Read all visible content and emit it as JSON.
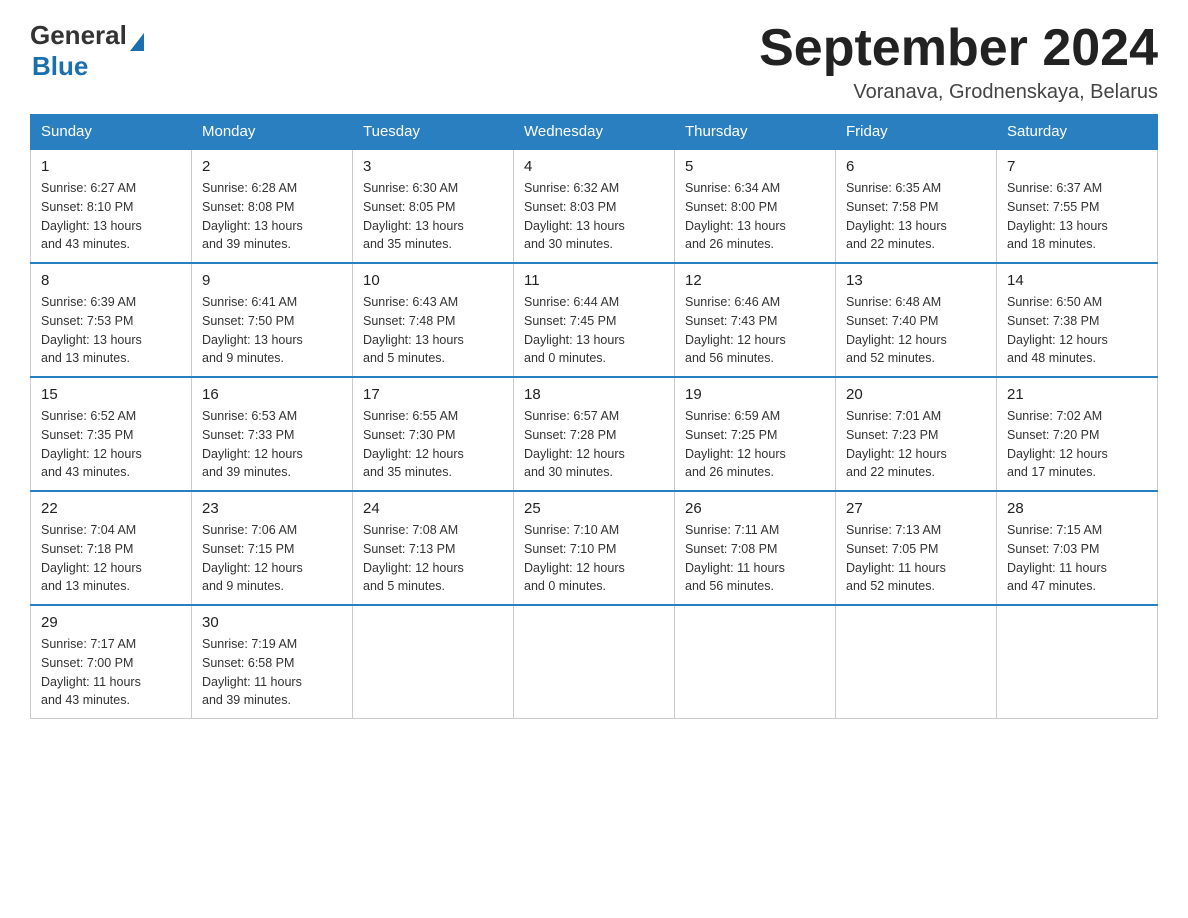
{
  "header": {
    "logo_general": "General",
    "logo_blue": "Blue",
    "month_title": "September 2024",
    "subtitle": "Voranava, Grodnenskaya, Belarus"
  },
  "days_of_week": [
    "Sunday",
    "Monday",
    "Tuesday",
    "Wednesday",
    "Thursday",
    "Friday",
    "Saturday"
  ],
  "weeks": [
    [
      {
        "day": "1",
        "info": "Sunrise: 6:27 AM\nSunset: 8:10 PM\nDaylight: 13 hours\nand 43 minutes."
      },
      {
        "day": "2",
        "info": "Sunrise: 6:28 AM\nSunset: 8:08 PM\nDaylight: 13 hours\nand 39 minutes."
      },
      {
        "day": "3",
        "info": "Sunrise: 6:30 AM\nSunset: 8:05 PM\nDaylight: 13 hours\nand 35 minutes."
      },
      {
        "day": "4",
        "info": "Sunrise: 6:32 AM\nSunset: 8:03 PM\nDaylight: 13 hours\nand 30 minutes."
      },
      {
        "day": "5",
        "info": "Sunrise: 6:34 AM\nSunset: 8:00 PM\nDaylight: 13 hours\nand 26 minutes."
      },
      {
        "day": "6",
        "info": "Sunrise: 6:35 AM\nSunset: 7:58 PM\nDaylight: 13 hours\nand 22 minutes."
      },
      {
        "day": "7",
        "info": "Sunrise: 6:37 AM\nSunset: 7:55 PM\nDaylight: 13 hours\nand 18 minutes."
      }
    ],
    [
      {
        "day": "8",
        "info": "Sunrise: 6:39 AM\nSunset: 7:53 PM\nDaylight: 13 hours\nand 13 minutes."
      },
      {
        "day": "9",
        "info": "Sunrise: 6:41 AM\nSunset: 7:50 PM\nDaylight: 13 hours\nand 9 minutes."
      },
      {
        "day": "10",
        "info": "Sunrise: 6:43 AM\nSunset: 7:48 PM\nDaylight: 13 hours\nand 5 minutes."
      },
      {
        "day": "11",
        "info": "Sunrise: 6:44 AM\nSunset: 7:45 PM\nDaylight: 13 hours\nand 0 minutes."
      },
      {
        "day": "12",
        "info": "Sunrise: 6:46 AM\nSunset: 7:43 PM\nDaylight: 12 hours\nand 56 minutes."
      },
      {
        "day": "13",
        "info": "Sunrise: 6:48 AM\nSunset: 7:40 PM\nDaylight: 12 hours\nand 52 minutes."
      },
      {
        "day": "14",
        "info": "Sunrise: 6:50 AM\nSunset: 7:38 PM\nDaylight: 12 hours\nand 48 minutes."
      }
    ],
    [
      {
        "day": "15",
        "info": "Sunrise: 6:52 AM\nSunset: 7:35 PM\nDaylight: 12 hours\nand 43 minutes."
      },
      {
        "day": "16",
        "info": "Sunrise: 6:53 AM\nSunset: 7:33 PM\nDaylight: 12 hours\nand 39 minutes."
      },
      {
        "day": "17",
        "info": "Sunrise: 6:55 AM\nSunset: 7:30 PM\nDaylight: 12 hours\nand 35 minutes."
      },
      {
        "day": "18",
        "info": "Sunrise: 6:57 AM\nSunset: 7:28 PM\nDaylight: 12 hours\nand 30 minutes."
      },
      {
        "day": "19",
        "info": "Sunrise: 6:59 AM\nSunset: 7:25 PM\nDaylight: 12 hours\nand 26 minutes."
      },
      {
        "day": "20",
        "info": "Sunrise: 7:01 AM\nSunset: 7:23 PM\nDaylight: 12 hours\nand 22 minutes."
      },
      {
        "day": "21",
        "info": "Sunrise: 7:02 AM\nSunset: 7:20 PM\nDaylight: 12 hours\nand 17 minutes."
      }
    ],
    [
      {
        "day": "22",
        "info": "Sunrise: 7:04 AM\nSunset: 7:18 PM\nDaylight: 12 hours\nand 13 minutes."
      },
      {
        "day": "23",
        "info": "Sunrise: 7:06 AM\nSunset: 7:15 PM\nDaylight: 12 hours\nand 9 minutes."
      },
      {
        "day": "24",
        "info": "Sunrise: 7:08 AM\nSunset: 7:13 PM\nDaylight: 12 hours\nand 5 minutes."
      },
      {
        "day": "25",
        "info": "Sunrise: 7:10 AM\nSunset: 7:10 PM\nDaylight: 12 hours\nand 0 minutes."
      },
      {
        "day": "26",
        "info": "Sunrise: 7:11 AM\nSunset: 7:08 PM\nDaylight: 11 hours\nand 56 minutes."
      },
      {
        "day": "27",
        "info": "Sunrise: 7:13 AM\nSunset: 7:05 PM\nDaylight: 11 hours\nand 52 minutes."
      },
      {
        "day": "28",
        "info": "Sunrise: 7:15 AM\nSunset: 7:03 PM\nDaylight: 11 hours\nand 47 minutes."
      }
    ],
    [
      {
        "day": "29",
        "info": "Sunrise: 7:17 AM\nSunset: 7:00 PM\nDaylight: 11 hours\nand 43 minutes."
      },
      {
        "day": "30",
        "info": "Sunrise: 7:19 AM\nSunset: 6:58 PM\nDaylight: 11 hours\nand 39 minutes."
      },
      {
        "day": "",
        "info": ""
      },
      {
        "day": "",
        "info": ""
      },
      {
        "day": "",
        "info": ""
      },
      {
        "day": "",
        "info": ""
      },
      {
        "day": "",
        "info": ""
      }
    ]
  ]
}
